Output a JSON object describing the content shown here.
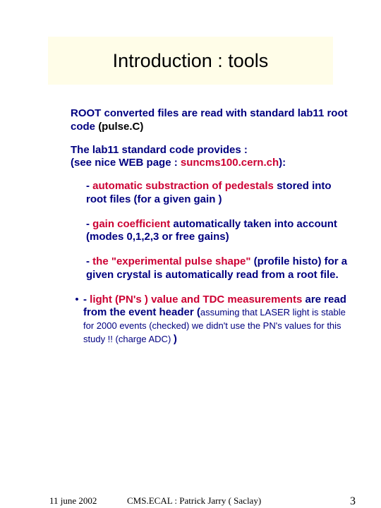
{
  "title": "Introduction : tools",
  "p1": {
    "lead": "ROOT converted files are read with standard lab11 root code ",
    "code": "(pulse.C)"
  },
  "p2": {
    "l1": "The lab11 standard code provides :",
    "l2a": "(see nice WEB page : ",
    "l2b": "suncms100.cern.ch",
    "l2c": "):"
  },
  "b1": {
    "dash": "- ",
    "red": "automatic substraction of pedestals",
    "rest": " stored into root files (for a given gain )"
  },
  "b2": {
    "dash": " - ",
    "red": "gain coefficient",
    "rest": " automatically taken into account (modes 0,1,2,3 or free gains)"
  },
  "b3": {
    "dash": "- ",
    "red": "the \"experimental pulse shape\"",
    "rest": " (profile histo) for a given crystal is automatically read from a root file."
  },
  "b4": {
    "dash": "- ",
    "red": "light (PN's ) value  and TDC measurements",
    "mid": " are read from the event header (",
    "small": "assuming that LASER light is stable for 2000 events (checked) we didn't use the PN's values for this study !! (charge ADC) ",
    "close": ")"
  },
  "footer": {
    "date": "11 june 2002",
    "center": "CMS.ECAL : Patrick Jarry ( Saclay)",
    "page": "3"
  }
}
